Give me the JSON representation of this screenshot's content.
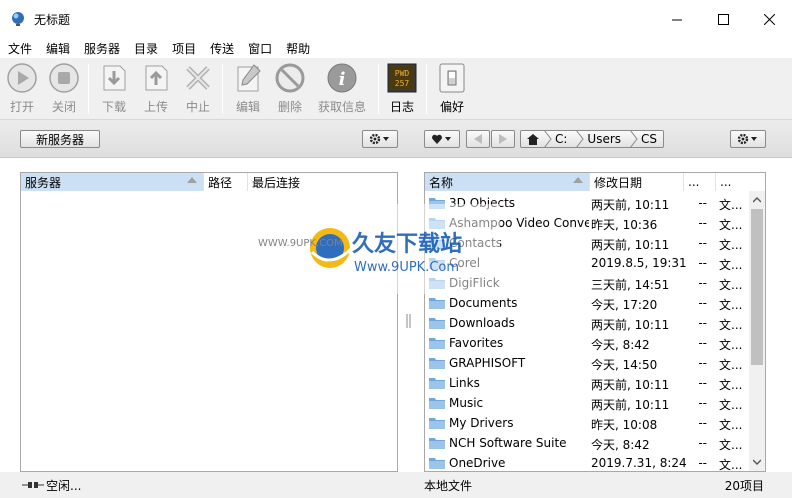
{
  "window": {
    "title": "无标题"
  },
  "menu": [
    "文件",
    "编辑",
    "服务器",
    "目录",
    "项目",
    "传送",
    "窗口",
    "帮助"
  ],
  "toolbar": {
    "open": "打开",
    "close": "关闭",
    "download": "下载",
    "upload": "上传",
    "abort": "中止",
    "edit": "编辑",
    "delete": "删除",
    "get_info": "获取信息",
    "log": "日志",
    "prefs": "偏好",
    "log_icon_text1": "PWD",
    "log_icon_text2": "257"
  },
  "servers_bar": {
    "new_server": "新服务器"
  },
  "breadcrumb": {
    "drive": "C:",
    "folder1": "Users",
    "folder2": "CS"
  },
  "server_panel": {
    "columns": {
      "server": "服务器",
      "path": "路径",
      "last_conn": "最后连接"
    }
  },
  "file_panel": {
    "columns": {
      "name": "名称",
      "modified": "修改日期",
      "size": "...",
      "type": "..."
    },
    "rows": [
      {
        "name": "3D Objects",
        "date": "两天前, 10:11",
        "size": "--",
        "type": "文..."
      },
      {
        "name": "Ashampoo Video Conve...",
        "date": "昨天, 10:36",
        "size": "--",
        "type": "文..."
      },
      {
        "name": "Contacts",
        "date": "两天前, 10:11",
        "size": "--",
        "type": "文..."
      },
      {
        "name": "Corel",
        "date": "2019.8.5, 19:31",
        "size": "--",
        "type": "文..."
      },
      {
        "name": "DigiFlick",
        "date": "三天前, 14:51",
        "size": "--",
        "type": "文..."
      },
      {
        "name": "Documents",
        "date": "今天, 17:20",
        "size": "--",
        "type": "文..."
      },
      {
        "name": "Downloads",
        "date": "两天前, 10:11",
        "size": "--",
        "type": "文..."
      },
      {
        "name": "Favorites",
        "date": "今天, 8:42",
        "size": "--",
        "type": "文..."
      },
      {
        "name": "GRAPHISOFT",
        "date": "今天, 14:50",
        "size": "--",
        "type": "文..."
      },
      {
        "name": "Links",
        "date": "两天前, 10:11",
        "size": "--",
        "type": "文..."
      },
      {
        "name": "Music",
        "date": "两天前, 10:11",
        "size": "--",
        "type": "文..."
      },
      {
        "name": "My Drivers",
        "date": "昨天, 10:08",
        "size": "--",
        "type": "文..."
      },
      {
        "name": "NCH Software Suite",
        "date": "今天, 8:42",
        "size": "--",
        "type": "文..."
      },
      {
        "name": "OneDrive",
        "date": "2019.7.31, 8:24",
        "size": "--",
        "type": "文..."
      }
    ]
  },
  "status": {
    "left": "空闲...",
    "local_files": "本地文件",
    "item_count": "20项目"
  },
  "watermark": {
    "brand": "久友下载站",
    "url_small": "WWW.9UPK.COM",
    "url": "Www.9UPK.Com"
  }
}
